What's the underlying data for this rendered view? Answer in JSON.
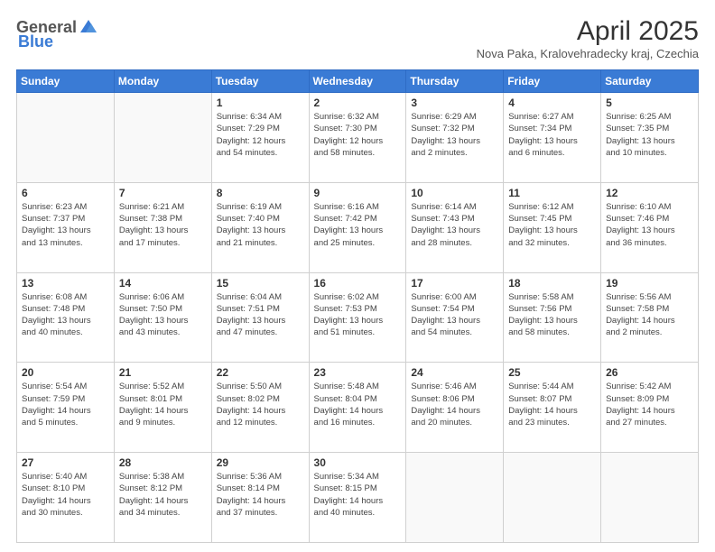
{
  "header": {
    "logo_general": "General",
    "logo_blue": "Blue",
    "title": "April 2025",
    "location": "Nova Paka, Kralovehradecky kraj, Czechia"
  },
  "weekdays": [
    "Sunday",
    "Monday",
    "Tuesday",
    "Wednesday",
    "Thursday",
    "Friday",
    "Saturday"
  ],
  "weeks": [
    [
      {
        "day": "",
        "info": ""
      },
      {
        "day": "",
        "info": ""
      },
      {
        "day": "1",
        "info": "Sunrise: 6:34 AM\nSunset: 7:29 PM\nDaylight: 12 hours\nand 54 minutes."
      },
      {
        "day": "2",
        "info": "Sunrise: 6:32 AM\nSunset: 7:30 PM\nDaylight: 12 hours\nand 58 minutes."
      },
      {
        "day": "3",
        "info": "Sunrise: 6:29 AM\nSunset: 7:32 PM\nDaylight: 13 hours\nand 2 minutes."
      },
      {
        "day": "4",
        "info": "Sunrise: 6:27 AM\nSunset: 7:34 PM\nDaylight: 13 hours\nand 6 minutes."
      },
      {
        "day": "5",
        "info": "Sunrise: 6:25 AM\nSunset: 7:35 PM\nDaylight: 13 hours\nand 10 minutes."
      }
    ],
    [
      {
        "day": "6",
        "info": "Sunrise: 6:23 AM\nSunset: 7:37 PM\nDaylight: 13 hours\nand 13 minutes."
      },
      {
        "day": "7",
        "info": "Sunrise: 6:21 AM\nSunset: 7:38 PM\nDaylight: 13 hours\nand 17 minutes."
      },
      {
        "day": "8",
        "info": "Sunrise: 6:19 AM\nSunset: 7:40 PM\nDaylight: 13 hours\nand 21 minutes."
      },
      {
        "day": "9",
        "info": "Sunrise: 6:16 AM\nSunset: 7:42 PM\nDaylight: 13 hours\nand 25 minutes."
      },
      {
        "day": "10",
        "info": "Sunrise: 6:14 AM\nSunset: 7:43 PM\nDaylight: 13 hours\nand 28 minutes."
      },
      {
        "day": "11",
        "info": "Sunrise: 6:12 AM\nSunset: 7:45 PM\nDaylight: 13 hours\nand 32 minutes."
      },
      {
        "day": "12",
        "info": "Sunrise: 6:10 AM\nSunset: 7:46 PM\nDaylight: 13 hours\nand 36 minutes."
      }
    ],
    [
      {
        "day": "13",
        "info": "Sunrise: 6:08 AM\nSunset: 7:48 PM\nDaylight: 13 hours\nand 40 minutes."
      },
      {
        "day": "14",
        "info": "Sunrise: 6:06 AM\nSunset: 7:50 PM\nDaylight: 13 hours\nand 43 minutes."
      },
      {
        "day": "15",
        "info": "Sunrise: 6:04 AM\nSunset: 7:51 PM\nDaylight: 13 hours\nand 47 minutes."
      },
      {
        "day": "16",
        "info": "Sunrise: 6:02 AM\nSunset: 7:53 PM\nDaylight: 13 hours\nand 51 minutes."
      },
      {
        "day": "17",
        "info": "Sunrise: 6:00 AM\nSunset: 7:54 PM\nDaylight: 13 hours\nand 54 minutes."
      },
      {
        "day": "18",
        "info": "Sunrise: 5:58 AM\nSunset: 7:56 PM\nDaylight: 13 hours\nand 58 minutes."
      },
      {
        "day": "19",
        "info": "Sunrise: 5:56 AM\nSunset: 7:58 PM\nDaylight: 14 hours\nand 2 minutes."
      }
    ],
    [
      {
        "day": "20",
        "info": "Sunrise: 5:54 AM\nSunset: 7:59 PM\nDaylight: 14 hours\nand 5 minutes."
      },
      {
        "day": "21",
        "info": "Sunrise: 5:52 AM\nSunset: 8:01 PM\nDaylight: 14 hours\nand 9 minutes."
      },
      {
        "day": "22",
        "info": "Sunrise: 5:50 AM\nSunset: 8:02 PM\nDaylight: 14 hours\nand 12 minutes."
      },
      {
        "day": "23",
        "info": "Sunrise: 5:48 AM\nSunset: 8:04 PM\nDaylight: 14 hours\nand 16 minutes."
      },
      {
        "day": "24",
        "info": "Sunrise: 5:46 AM\nSunset: 8:06 PM\nDaylight: 14 hours\nand 20 minutes."
      },
      {
        "day": "25",
        "info": "Sunrise: 5:44 AM\nSunset: 8:07 PM\nDaylight: 14 hours\nand 23 minutes."
      },
      {
        "day": "26",
        "info": "Sunrise: 5:42 AM\nSunset: 8:09 PM\nDaylight: 14 hours\nand 27 minutes."
      }
    ],
    [
      {
        "day": "27",
        "info": "Sunrise: 5:40 AM\nSunset: 8:10 PM\nDaylight: 14 hours\nand 30 minutes."
      },
      {
        "day": "28",
        "info": "Sunrise: 5:38 AM\nSunset: 8:12 PM\nDaylight: 14 hours\nand 34 minutes."
      },
      {
        "day": "29",
        "info": "Sunrise: 5:36 AM\nSunset: 8:14 PM\nDaylight: 14 hours\nand 37 minutes."
      },
      {
        "day": "30",
        "info": "Sunrise: 5:34 AM\nSunset: 8:15 PM\nDaylight: 14 hours\nand 40 minutes."
      },
      {
        "day": "",
        "info": ""
      },
      {
        "day": "",
        "info": ""
      },
      {
        "day": "",
        "info": ""
      }
    ]
  ]
}
